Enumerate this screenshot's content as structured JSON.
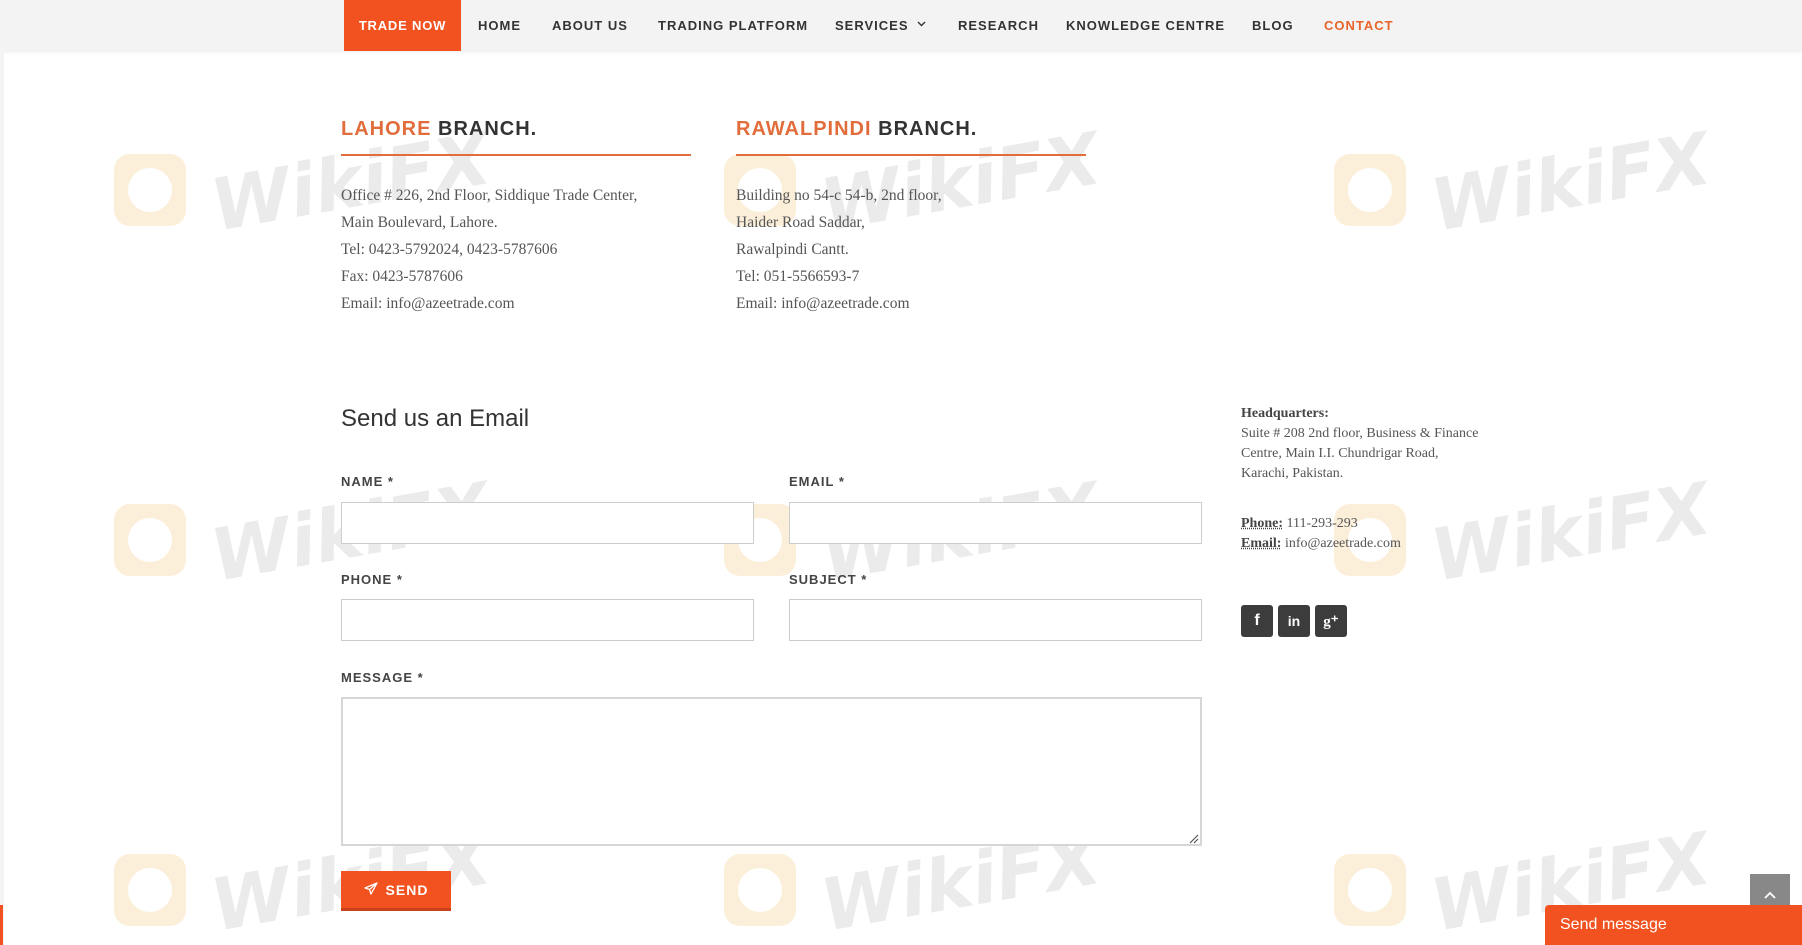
{
  "nav": {
    "cta": "TRADE NOW",
    "items": [
      "HOME",
      "ABOUT US",
      "TRADING PLATFORM",
      "SERVICES",
      "RESEARCH",
      "KNOWLEDGE CENTRE",
      "BLOG",
      "CONTACT"
    ],
    "active": "CONTACT",
    "dropdown_icon": "chevron-down-icon"
  },
  "branches": [
    {
      "city": "LAHORE",
      "suffix": " BRANCH.",
      "lines": [
        "Office # 226, 2nd Floor, Siddique Trade Center,",
        "Main Boulevard, Lahore.",
        "Tel: 0423-5792024, 0423-5787606",
        "Fax: 0423-5787606",
        "Email: info@azeetrade.com"
      ]
    },
    {
      "city": "RAWALPINDI",
      "suffix": " BRANCH.",
      "lines": [
        "Building no 54-c 54-b, 2nd floor,",
        "Haider Road Saddar,",
        "Rawalpindi Cantt.",
        "Tel: 051-5566593-7",
        "Email: info@azeetrade.com"
      ]
    }
  ],
  "form": {
    "title": "Send us an Email",
    "labels": {
      "name": "NAME *",
      "email": "EMAIL *",
      "phone": "PHONE *",
      "subject": "SUBJECT *",
      "message": "MESSAGE *"
    },
    "values": {
      "name": "",
      "email": "",
      "phone": "",
      "subject": "",
      "message": ""
    },
    "send_label": "SEND",
    "send_icon": "paper-plane-icon"
  },
  "headquarters": {
    "title": "Headquarters:",
    "address": "Suite # 208 2nd floor, Business & Finance Centre, Main I.I. Chundrigar Road, Karachi, Pakistan.",
    "phone_label": "Phone:",
    "phone": "111-293-293",
    "email_label": "Email:",
    "email": "info@azeetrade.com"
  },
  "socials": [
    {
      "name": "facebook",
      "glyph": "f"
    },
    {
      "name": "linkedin",
      "glyph": "in"
    },
    {
      "name": "google-plus",
      "glyph": "g⁺"
    }
  ],
  "widgets": {
    "send_message": "Send message",
    "scroll_top_icon": "chevron-up-icon"
  },
  "watermark": {
    "text": "WikiFX"
  },
  "colors": {
    "accent": "#f2521f",
    "heading_accent": "#e26d3c",
    "dark_button": "#3c3c3c"
  }
}
